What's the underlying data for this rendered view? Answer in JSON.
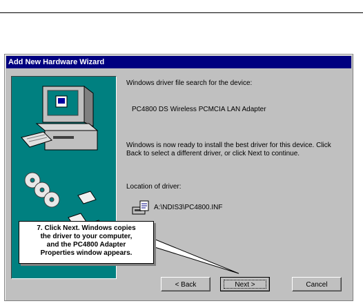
{
  "dialog": {
    "title": "Add New Hardware Wizard"
  },
  "content": {
    "intro": "Windows driver file search for the device:",
    "device_name": "PC4800 DS Wireless PCMCIA LAN Adapter",
    "ready_text": "Windows is now ready to install the best driver for this device. Click Back to select a different driver, or click Next to continue.",
    "location_label": "Location of driver:",
    "driver_path": "A:\\NDIS3\\PC4800.INF",
    "driver_icon": "driver-file-icon"
  },
  "buttons": {
    "back_label": "< Back",
    "next_label": "Next >",
    "cancel_label": "Cancel"
  },
  "callout": {
    "line1": "7. Click Next. Windows copies",
    "line2": "the driver to your computer,",
    "line3": "and the PC4800 Adapter",
    "line4": "Properties window appears."
  },
  "colors": {
    "title_bar": "#000080",
    "dialog_face": "#c0c0c0",
    "art_panel": "#008080"
  }
}
